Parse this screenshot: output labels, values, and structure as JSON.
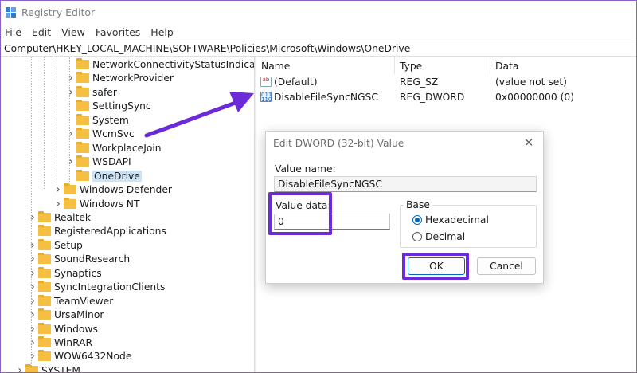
{
  "window": {
    "title": "Registry Editor"
  },
  "menu": [
    {
      "label": "File",
      "key": "F",
      "rest": "ile"
    },
    {
      "label": "Edit",
      "key": "E",
      "rest": "dit"
    },
    {
      "label": "View",
      "key": "V",
      "rest": "iew"
    },
    {
      "label": "Favorites",
      "key": "",
      "rest": "Favorites"
    },
    {
      "label": "Help",
      "key": "H",
      "rest": "elp"
    }
  ],
  "address": "Computer\\HKEY_LOCAL_MACHINE\\SOFTWARE\\Policies\\Microsoft\\Windows\\OneDrive",
  "tree": {
    "items": [
      {
        "label": "NetworkConnectivityStatusIndica",
        "expander": false,
        "selected": false
      },
      {
        "label": "NetworkProvider",
        "expander": true,
        "selected": false
      },
      {
        "label": "safer",
        "expander": true,
        "selected": false
      },
      {
        "label": "SettingSync",
        "expander": false,
        "selected": false
      },
      {
        "label": "System",
        "expander": false,
        "selected": false
      },
      {
        "label": "WcmSvc",
        "expander": true,
        "selected": false
      },
      {
        "label": "WorkplaceJoin",
        "expander": false,
        "selected": false
      },
      {
        "label": "WSDAPI",
        "expander": true,
        "selected": false
      },
      {
        "label": "OneDrive",
        "expander": false,
        "selected": true
      },
      {
        "label": "Windows Defender",
        "expander": true,
        "selected": false
      },
      {
        "label": "Windows NT",
        "expander": true,
        "selected": false
      },
      {
        "label": "Realtek",
        "expander": true,
        "selected": false
      },
      {
        "label": "RegisteredApplications",
        "expander": false,
        "selected": false
      },
      {
        "label": "Setup",
        "expander": true,
        "selected": false
      },
      {
        "label": "SoundResearch",
        "expander": true,
        "selected": false
      },
      {
        "label": "Synaptics",
        "expander": true,
        "selected": false
      },
      {
        "label": "SyncIntegrationClients",
        "expander": true,
        "selected": false
      },
      {
        "label": "TeamViewer",
        "expander": true,
        "selected": false
      },
      {
        "label": "UrsaMinor",
        "expander": true,
        "selected": false
      },
      {
        "label": "Windows",
        "expander": true,
        "selected": false
      },
      {
        "label": "WinRAR",
        "expander": true,
        "selected": false
      },
      {
        "label": "WOW6432Node",
        "expander": true,
        "selected": false
      },
      {
        "label": "SYSTEM",
        "expander": true,
        "selected": false
      }
    ]
  },
  "values": {
    "headers": {
      "name": "Name",
      "type": "Type",
      "data": "Data"
    },
    "rows": [
      {
        "icon": "string-value-icon",
        "icon_text": "ab",
        "name": "(Default)",
        "type": "REG_SZ",
        "data": "(value not set)"
      },
      {
        "icon": "dword-value-icon",
        "icon_text": "011 110",
        "name": "DisableFileSyncNGSC",
        "type": "REG_DWORD",
        "data": "0x00000000 (0)"
      }
    ]
  },
  "dialog": {
    "title": "Edit DWORD (32-bit) Value",
    "close_icon": "close-icon",
    "value_name_label": "Value name:",
    "value_name": "DisableFileSyncNGSC",
    "value_data_label": "Value data:",
    "value_data": "0",
    "base_label": "Base",
    "hex_label": "Hexadecimal",
    "dec_label": "Decimal",
    "base_selected": "Hexadecimal",
    "ok_label": "OK",
    "cancel_label": "Cancel"
  },
  "colors": {
    "highlight": "#6c2bd9",
    "accent": "#0067c0",
    "selection": "#cce4f7"
  }
}
